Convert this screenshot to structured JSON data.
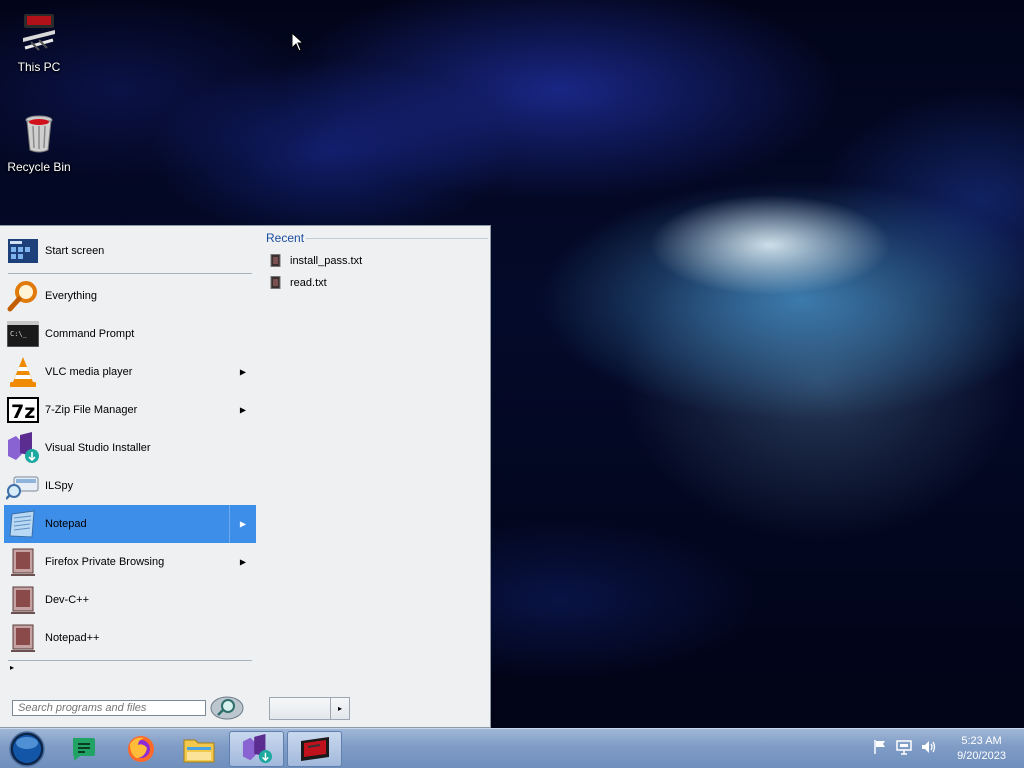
{
  "desktop": {
    "icons": [
      {
        "label": "This PC",
        "icon": "this-pc-icon"
      },
      {
        "label": "Recycle Bin",
        "icon": "recycle-bin-icon"
      }
    ]
  },
  "start_menu": {
    "programs": [
      {
        "label": "Start screen",
        "icon": "start-screen-icon",
        "submenu": false
      },
      {
        "label": "Everything",
        "icon": "everything-search-icon",
        "submenu": false
      },
      {
        "label": "Command Prompt",
        "icon": "command-prompt-icon",
        "submenu": false
      },
      {
        "label": "VLC media player",
        "icon": "vlc-cone-icon",
        "submenu": true
      },
      {
        "label": "7-Zip File Manager",
        "icon": "7zip-icon",
        "submenu": true
      },
      {
        "label": "Visual Studio Installer",
        "icon": "visual-studio-installer-icon",
        "submenu": false
      },
      {
        "label": "ILSpy",
        "icon": "ilspy-icon",
        "submenu": false
      },
      {
        "label": "Notepad",
        "icon": "notepad-icon",
        "submenu": true,
        "selected": true
      },
      {
        "label": "Firefox Private Browsing",
        "icon": "generic-app-icon",
        "submenu": true
      },
      {
        "label": "Dev-C++",
        "icon": "generic-app-icon",
        "submenu": false
      },
      {
        "label": "Notepad++",
        "icon": "generic-app-icon",
        "submenu": false
      }
    ],
    "all_programs_arrow": "▸",
    "search": {
      "placeholder": "Search programs and files"
    },
    "recent": {
      "title": "Recent",
      "items": [
        {
          "label": "install_pass.txt",
          "icon": "text-file-icon"
        },
        {
          "label": "read.txt",
          "icon": "text-file-icon"
        }
      ]
    },
    "shutdown_arrow": "▸",
    "selected_color": "#3d8ee9"
  },
  "taskbar": {
    "apps": [
      {
        "name": "start-orb",
        "active": false
      },
      {
        "name": "google-chat-icon",
        "active": false
      },
      {
        "name": "firefox-icon",
        "active": false
      },
      {
        "name": "file-explorer-icon",
        "active": false
      },
      {
        "name": "visual-studio-installer-icon",
        "active": true
      },
      {
        "name": "this-pc-icon",
        "active": true
      }
    ],
    "tray": [
      "flag-icon",
      "network-icon",
      "volume-icon"
    ],
    "clock": {
      "time": "5:23 AM",
      "date": "9/20/2023"
    }
  }
}
